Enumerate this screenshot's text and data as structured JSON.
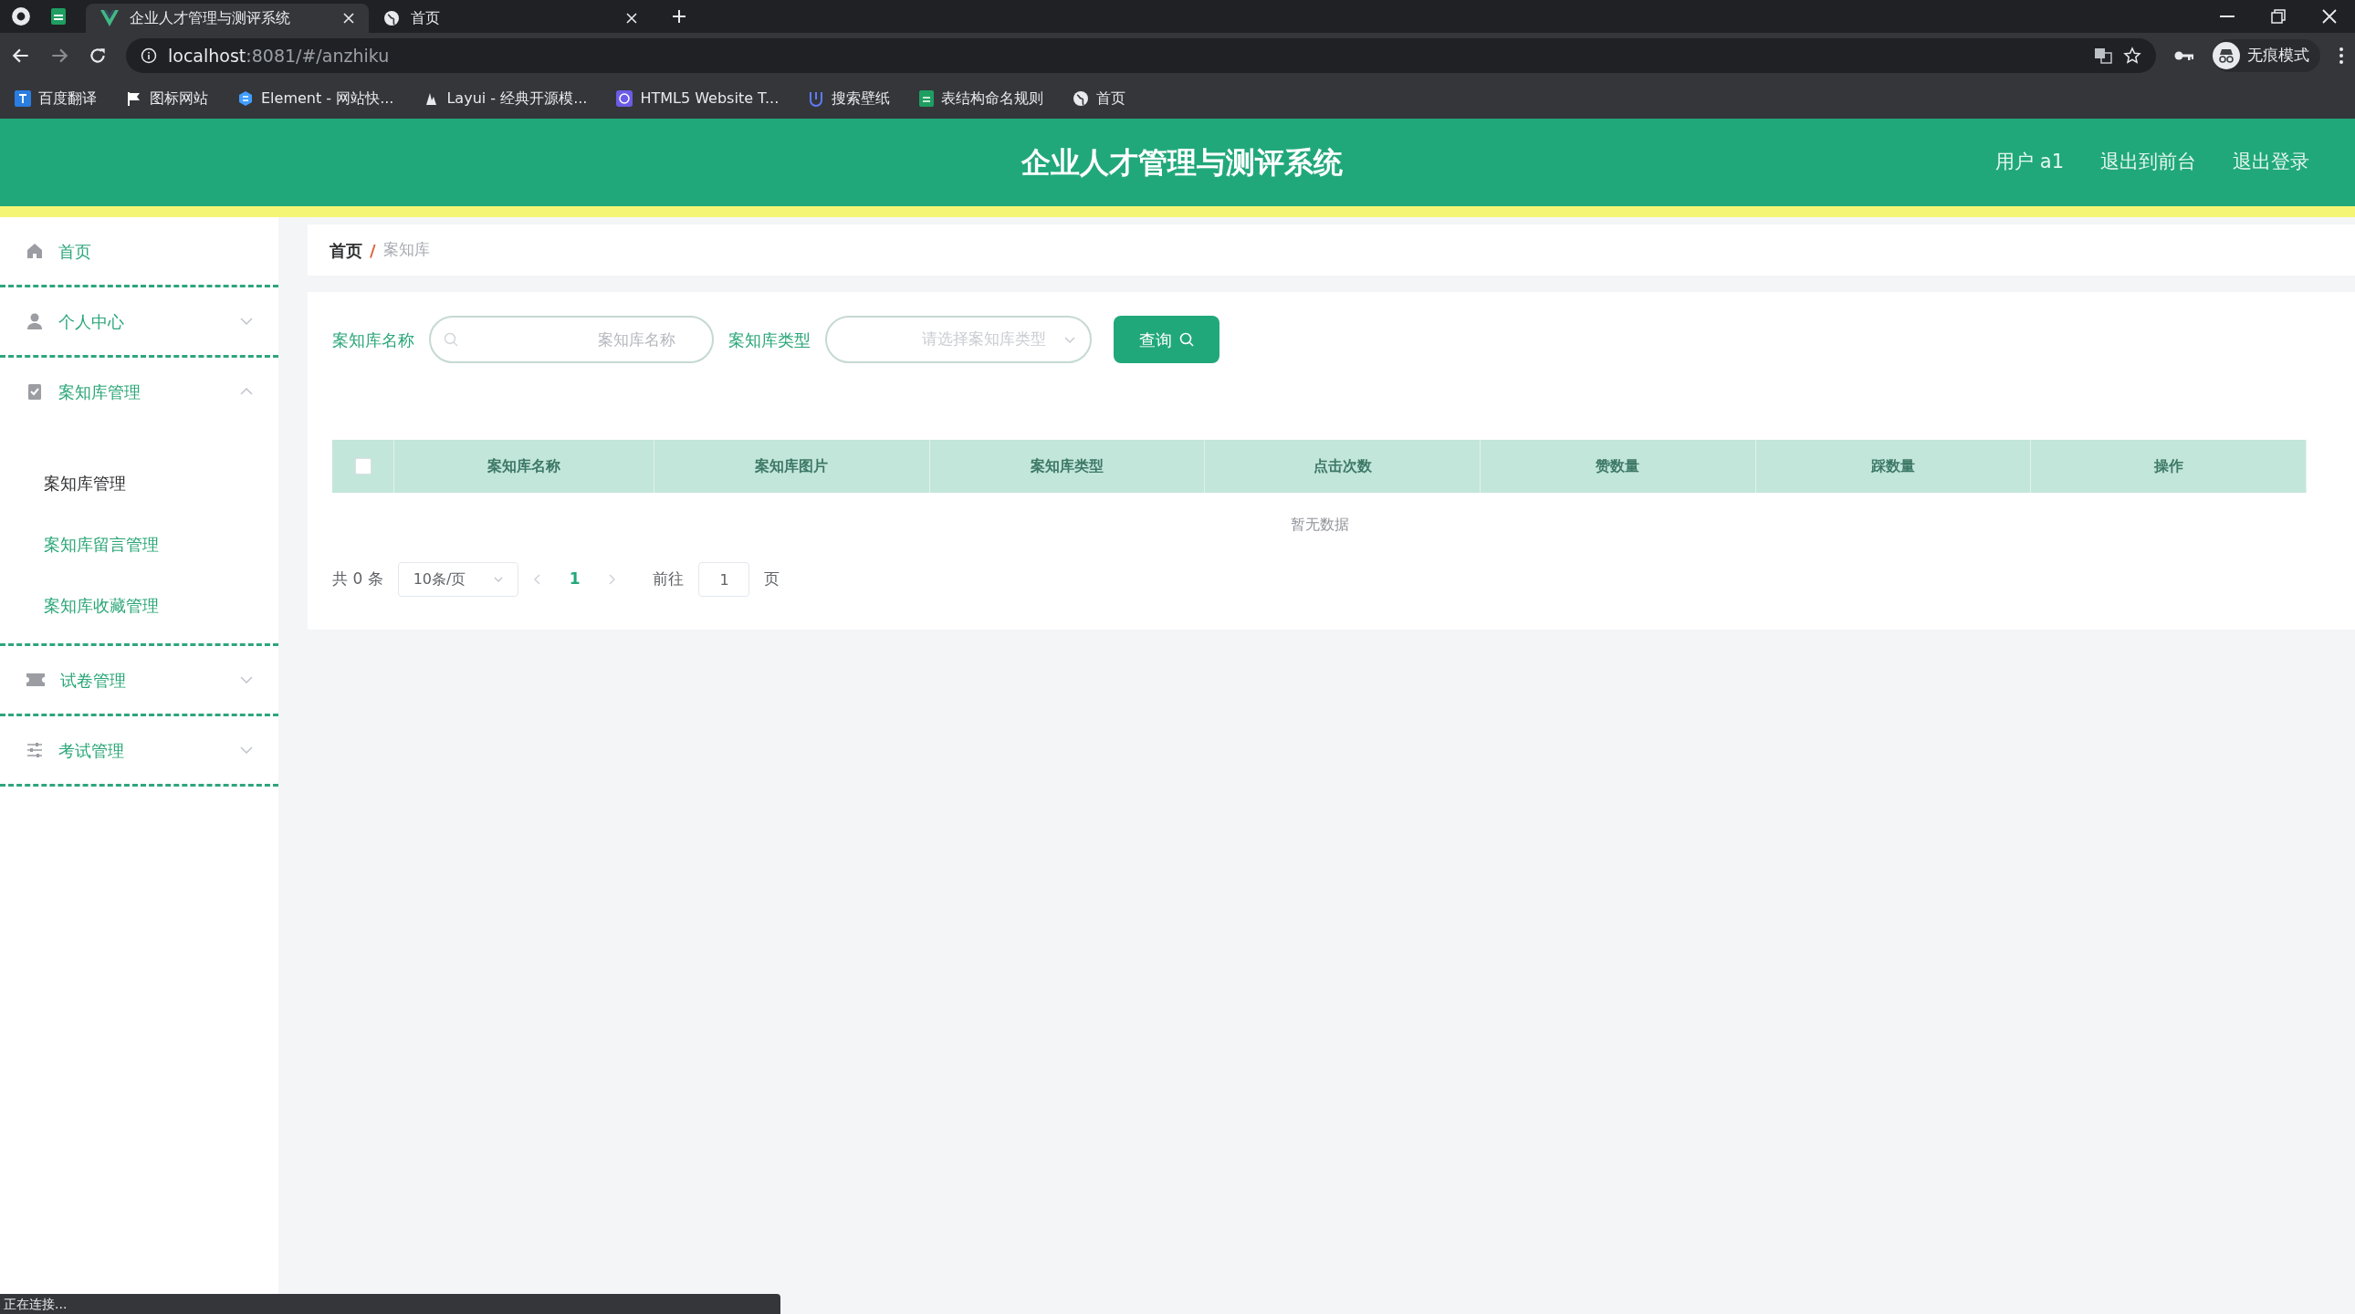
{
  "browser": {
    "tabs": [
      {
        "title": "企业人才管理与测评系统",
        "selected": true
      },
      {
        "title": "首页",
        "selected": false
      }
    ],
    "address": {
      "host": "localhost",
      "path": ":8081/#/anzhiku"
    },
    "bookmarks": [
      "百度翻译",
      "图标网站",
      "Element - 网站快...",
      "Layui - 经典开源模...",
      "HTML5 Website T...",
      "搜索壁纸",
      "表结构命名规则",
      "首页"
    ],
    "profile": "无痕模式"
  },
  "app": {
    "title": "企业人才管理与测评系统",
    "header_links": [
      "用户 a1",
      "退出到前台",
      "退出登录"
    ],
    "sidebar": [
      {
        "label": "首页"
      },
      {
        "label": "个人中心",
        "expanded": false
      },
      {
        "label": "案知库管理",
        "expanded": true,
        "children": [
          {
            "label": "案知库管理",
            "selected": true
          },
          {
            "label": "案知库留言管理",
            "selected": false
          },
          {
            "label": "案知库收藏管理",
            "selected": false
          }
        ]
      },
      {
        "label": "试卷管理",
        "expanded": false
      },
      {
        "label": "考试管理",
        "expanded": false
      }
    ],
    "breadcrumb": {
      "separator": "/",
      "items": [
        {
          "label": "首页",
          "current": false
        },
        {
          "label": "案知库",
          "current": true
        }
      ]
    },
    "search": [
      {
        "kind": "text",
        "label": "案知库名称",
        "placeholder": "案知库名称"
      },
      {
        "kind": "select",
        "label": "案知库类型",
        "placeholder": "请选择案知库类型"
      }
    ],
    "query_button": "查询",
    "table": {
      "select_all_checked": false,
      "columns": [
        "案知库名称",
        "案知库图片",
        "案知库类型",
        "点击次数",
        "赞数量",
        "踩数量",
        "操作"
      ],
      "empty_text": "暂无数据"
    },
    "pagination": {
      "total": "共 0 条",
      "page_size": "10条/页",
      "pages": [
        {
          "label": "1",
          "selected": true
        }
      ],
      "goto_label": "前往",
      "goto_value": "1",
      "page_suffix": "页"
    }
  },
  "status_bar": "正在连接..."
}
